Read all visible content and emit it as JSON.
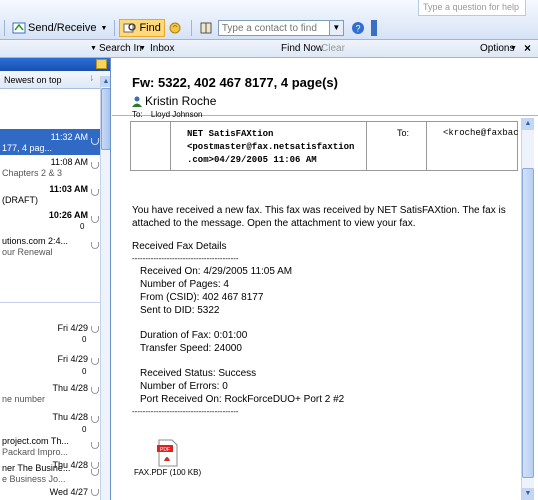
{
  "toolbar": {
    "ask_placeholder": "Type a question for help",
    "send_receive_label": "Send/Receive",
    "find_label": "Find",
    "contact_placeholder": "Type a contact to find"
  },
  "search": {
    "search_in_label": "Search In",
    "folder": "Inbox",
    "find_now_label": "Find Now",
    "clear_label": "Clear",
    "options_label": "Options",
    "close_glyph": "×"
  },
  "list": {
    "arrange_label": "Newest on top",
    "items": [
      {
        "time": "11:32 AM",
        "preview": "177, 4 pag...",
        "selected": true
      },
      {
        "time": "11:08 AM",
        "preview": "Chapters 2 & 3"
      },
      {
        "time": "11:03 AM",
        "preview": "(DRAFT)",
        "bold": true
      },
      {
        "time": "10:26 AM",
        "preview": "",
        "bold": true
      },
      {
        "time": "",
        "preview": "utions.com 2:4...",
        "preview2": "our Renewal"
      },
      {
        "time": "Fri 4/29",
        "preview": ""
      },
      {
        "time": "Fri 4/29",
        "preview": ""
      },
      {
        "time": "Thu 4/28",
        "preview": "ne number"
      },
      {
        "time": "Thu 4/28",
        "preview": ""
      },
      {
        "time": "",
        "preview": "project.com Th...",
        "preview2": "Packard Impro..."
      },
      {
        "time": "",
        "preview": "ner The Busine...",
        "preview2": "e Business Jo..."
      },
      {
        "time": "Thu 4/28",
        "preview": ""
      },
      {
        "time": "Wed 4/27",
        "preview": ""
      }
    ]
  },
  "message": {
    "subject": "Fw: 5322, 402 467 8177, 4 page(s)",
    "sender": "Kristin Roche",
    "to_label": "To:",
    "to_value": "Lloyd Johnson",
    "fax_header": {
      "from_line1": "NET SatisFAXtion",
      "from_line2": "<postmaster@fax.netsatisfaxtion",
      "from_line3": ".com>04/29/2005 11:06 AM",
      "to_label": "To:",
      "to_value": "<kroche@faxbac"
    },
    "intro": "You have received a new fax. This fax was received by NET SatisFAXtion.  The fax is attached to the message.  Open the attachment to view your fax.",
    "details_title": "Received Fax Details",
    "separator": "----------------------------------------",
    "received_on": "Received On:     4/29/2005 11:05 AM",
    "pages": "Number of Pages:  4",
    "csid": "From (CSID):      402 467 8177",
    "did": "Sent to DID:       5322",
    "duration": "Duration of Fax:  0:01:00",
    "speed": "Transfer Speed:   24000",
    "status": "Received Status:  Success",
    "errors": "Number of Errors: 0",
    "port": "Port Received On: RockForceDUO+ Port 2 #2",
    "attachment": "FAX.PDF (100 KB)"
  }
}
